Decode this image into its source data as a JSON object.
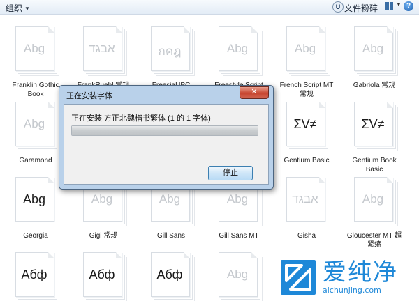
{
  "toolbar": {
    "organize_label": "组织",
    "user_badge": "U",
    "preview_label": "文件粉碎",
    "help_label": "?"
  },
  "fonts": [
    {
      "label": "Franklin Gothic Book",
      "glyph": "Abg",
      "dark": false
    },
    {
      "label": "FrankRuehl 常规",
      "glyph": "אבגד",
      "dark": false
    },
    {
      "label": "FreesiaUPC",
      "glyph": "กคฎ",
      "dark": false
    },
    {
      "label": "Freestyle Script",
      "glyph": "Abg",
      "dark": false
    },
    {
      "label": "French Script MT 常规",
      "glyph": "Abg",
      "dark": false
    },
    {
      "label": "Gabriola 常规",
      "glyph": "Abg",
      "dark": false
    },
    {
      "label": "Garamond",
      "glyph": "Abg",
      "dark": false
    },
    {
      "label": "Gentium Basic",
      "glyph": "ΣV≠",
      "dark": true
    },
    {
      "label": "Gentium Book Basic",
      "glyph": "ΣV≠",
      "dark": true
    },
    {
      "label": "Georgia",
      "glyph": "Abg",
      "dark": true
    },
    {
      "label": "Gigi 常规",
      "glyph": "Abg",
      "dark": false
    },
    {
      "label": "Gill Sans",
      "glyph": "Abg",
      "dark": false
    },
    {
      "label": "Gill Sans MT",
      "glyph": "Abg",
      "dark": false
    },
    {
      "label": "Gisha",
      "glyph": "אבגד",
      "dark": false
    },
    {
      "label": "Gloucester MT 超紧缩",
      "glyph": "Abg",
      "dark": false
    },
    {
      "label": "",
      "glyph": "Абф",
      "dark": true
    },
    {
      "label": "",
      "glyph": "Абф",
      "dark": true
    },
    {
      "label": "",
      "glyph": "Абф",
      "dark": true
    },
    {
      "label": "",
      "glyph": "Abg",
      "dark": false
    }
  ],
  "dialog": {
    "title": "正在安装字体",
    "close_label": "✕",
    "message": "正在安装 方正北魏楷书繁体 (1 的 1 字体)",
    "progress_fraction": 1.0,
    "stop_label": "停止"
  },
  "watermark": {
    "brand": "爱纯净",
    "url": "aichunjing.com"
  }
}
